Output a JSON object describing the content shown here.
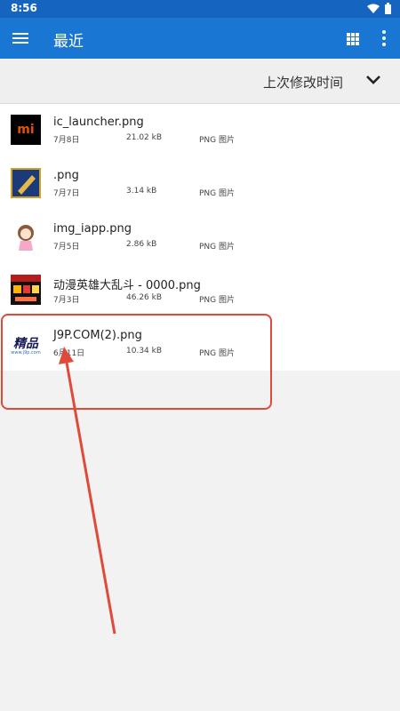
{
  "status_bar": {
    "time": "8:56"
  },
  "app_bar": {
    "title": "最近"
  },
  "sort": {
    "label": "上次修改时间"
  },
  "files": [
    {
      "name": "ic_launcher.png",
      "date": "7月8日",
      "size": "21.02 kB",
      "type": "PNG 图片",
      "thumb_text": "mi"
    },
    {
      "name": ".png",
      "date": "7月7日",
      "size": "3.14 kB",
      "type": "PNG 图片"
    },
    {
      "name": "img_iapp.png",
      "date": "7月5日",
      "size": "2.86 kB",
      "type": "PNG 图片"
    },
    {
      "name": "动漫英雄大乱斗 - 0000.png",
      "date": "7月3日",
      "size": "46.26 kB",
      "type": "PNG 图片"
    },
    {
      "name": "J9P.COM(2).png",
      "date": "6月11日",
      "size": "10.34 kB",
      "type": "PNG 图片",
      "thumb_text": "精品",
      "thumb_sub": "www.j9p.com"
    }
  ],
  "colors": {
    "status_bar": "#1565c0",
    "app_bar": "#1976d2",
    "annotation": "#e04a3a"
  }
}
